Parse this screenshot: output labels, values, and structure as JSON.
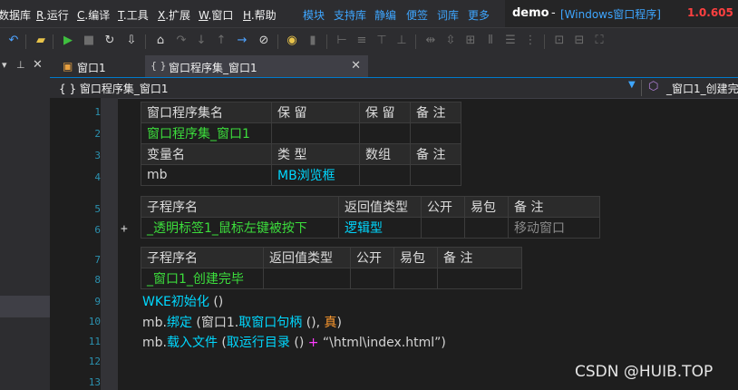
{
  "menu": {
    "items": [
      {
        "label": "数据库"
      },
      {
        "key": "R",
        "label": ".运行"
      },
      {
        "key": "C",
        "label": ".编译"
      },
      {
        "key": "T",
        "label": ".工具"
      },
      {
        "key": "X",
        "label": ".扩展"
      },
      {
        "key": "W",
        "label": ".窗口"
      },
      {
        "key": "H",
        "label": ".帮助"
      }
    ],
    "quick_links": [
      "模块",
      "支持库",
      "静编",
      "便签",
      "词库",
      "更多"
    ]
  },
  "project": {
    "name": "demo",
    "separator": "-",
    "type": "[Windows窗口程序]",
    "version": "1.0.605"
  },
  "tabs": [
    {
      "label": "窗口1",
      "active": false
    },
    {
      "label": "窗口程序集_窗口1",
      "active": true
    }
  ],
  "navbar": {
    "left": "{ } 窗口程序集_窗口1",
    "right": "_窗口1_创建完"
  },
  "line_numbers": [
    "1",
    "2",
    "3",
    "4",
    "5",
    "6",
    "7",
    "8",
    "9",
    "10",
    "11",
    "12",
    "13"
  ],
  "gutter_marker": "+",
  "assembly_table": {
    "header1": [
      "窗口程序集名",
      "保 留",
      "保 留",
      "备 注"
    ],
    "row1": [
      "窗口程序集_窗口1",
      "",
      "",
      ""
    ],
    "header2": [
      "变量名",
      "类 型",
      "数组",
      "备 注"
    ],
    "row2": [
      "mb",
      "MB浏览框",
      "",
      ""
    ]
  },
  "sub1_table": {
    "header": [
      "子程序名",
      "返回值类型",
      "公开",
      "易包",
      "备 注"
    ],
    "row": [
      "_透明标签1_鼠标左键被按下",
      "逻辑型",
      "",
      "",
      "移动窗口"
    ]
  },
  "sub2_table": {
    "header": [
      "子程序名",
      "返回值类型",
      "公开",
      "易包",
      "备 注"
    ],
    "row": [
      "_窗口1_创建完毕",
      "",
      "",
      "",
      ""
    ]
  },
  "code": {
    "line9": {
      "fn": "WKE初始化",
      "rest": " ()"
    },
    "line10": {
      "obj": "mb.",
      "fn": "绑定",
      "p1": " (窗口1.",
      "fn2": "取窗口句柄",
      "p2": " (), ",
      "lit": "真",
      "p3": ")"
    },
    "line11": {
      "obj": "mb.",
      "fn": "载入文件",
      "p1": " (",
      "fn2": "取运行目录",
      "p2": " () ",
      "op": "+",
      "str": " “\\html\\index.html”",
      "p3": ")"
    }
  },
  "watermark": "CSDN @HUIB.TOP",
  "colors": {
    "accent": "#007acc",
    "green_text": "#3cdd3c",
    "cyan_text": "#00d8ff",
    "version_red": "#ff4040"
  }
}
